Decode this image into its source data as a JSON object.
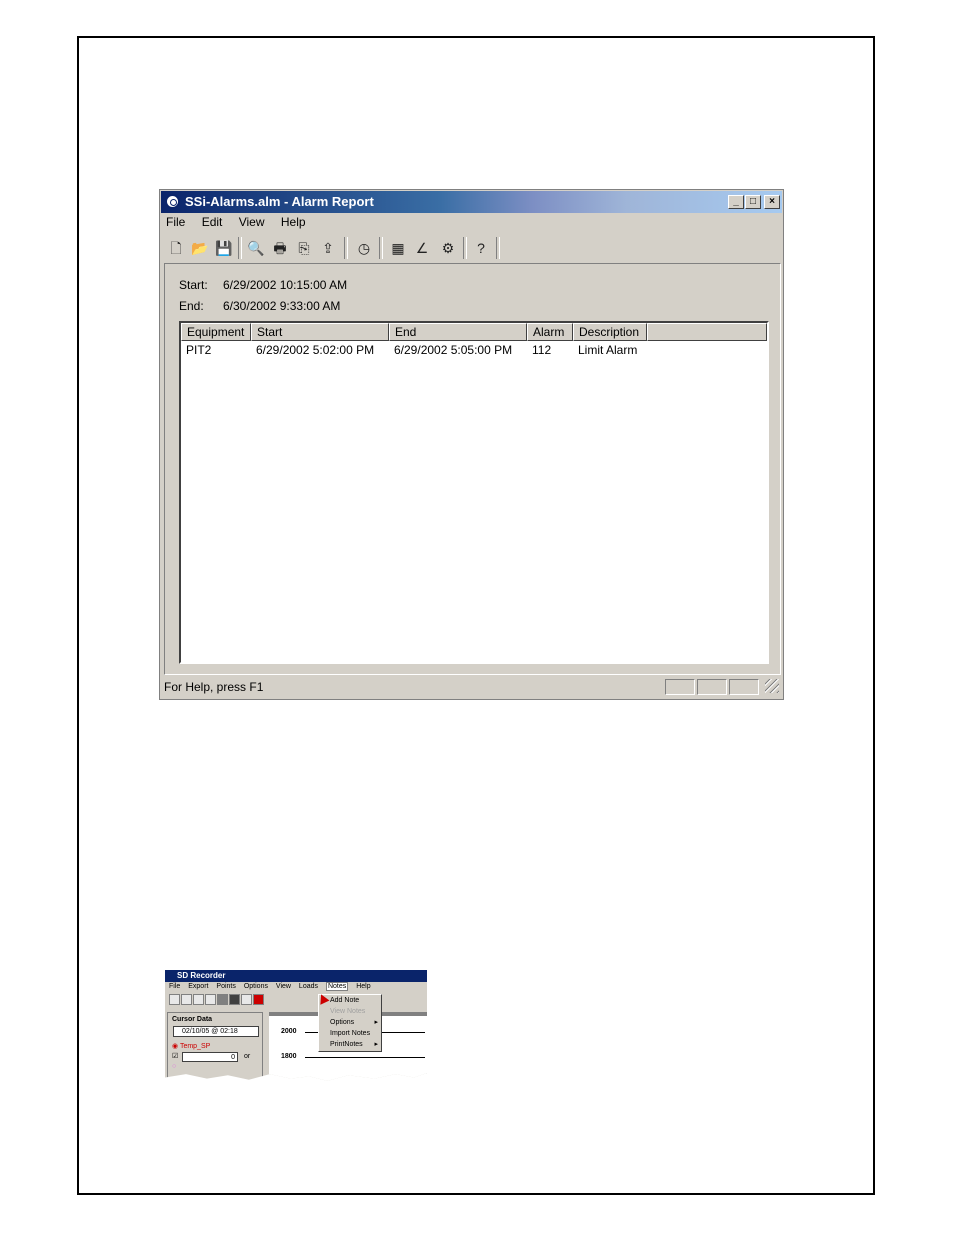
{
  "window": {
    "title": "SSi-Alarms.alm - Alarm Report",
    "controls": {
      "minimize": "_",
      "maximize": "□",
      "close": "×"
    },
    "menu": [
      "File",
      "Edit",
      "View",
      "Help"
    ],
    "toolbar_icons": [
      "new-icon",
      "open-icon",
      "save-icon",
      "print-preview-icon",
      "print-icon",
      "copy-icon",
      "export-icon",
      "clock-icon",
      "grid-icon",
      "chart-icon",
      "settings-icon",
      "help-icon"
    ],
    "start_label": "Start:",
    "start_value": "6/29/2002 10:15:00 AM",
    "end_label": "End:",
    "end_value": "6/30/2002 9:33:00 AM",
    "table": {
      "columns": [
        "Equipment",
        "Start",
        "End",
        "Alarm",
        "Description"
      ],
      "rows": [
        [
          "PIT2",
          "6/29/2002 5:02:00 PM",
          "6/29/2002 5:05:00 PM",
          "112",
          "Limit Alarm"
        ]
      ]
    },
    "status": "For Help, press F1"
  },
  "sd_recorder": {
    "title": "SD Recorder",
    "menu": [
      "File",
      "Export",
      "Points",
      "Options",
      "View",
      "Loads",
      "Notes",
      "Help"
    ],
    "active_menu": "Notes",
    "panel_title": "Cursor Data",
    "cursor_value": "02/10/05 @ 02:18",
    "point_label": "Temp_SP",
    "stepper_value": "0",
    "or_label": "or",
    "axis_2000": "2000",
    "axis_1800": "1800",
    "dropdown": [
      "Add Note",
      "View Notes",
      "Options",
      "Import Notes",
      "PrintNotes"
    ]
  }
}
